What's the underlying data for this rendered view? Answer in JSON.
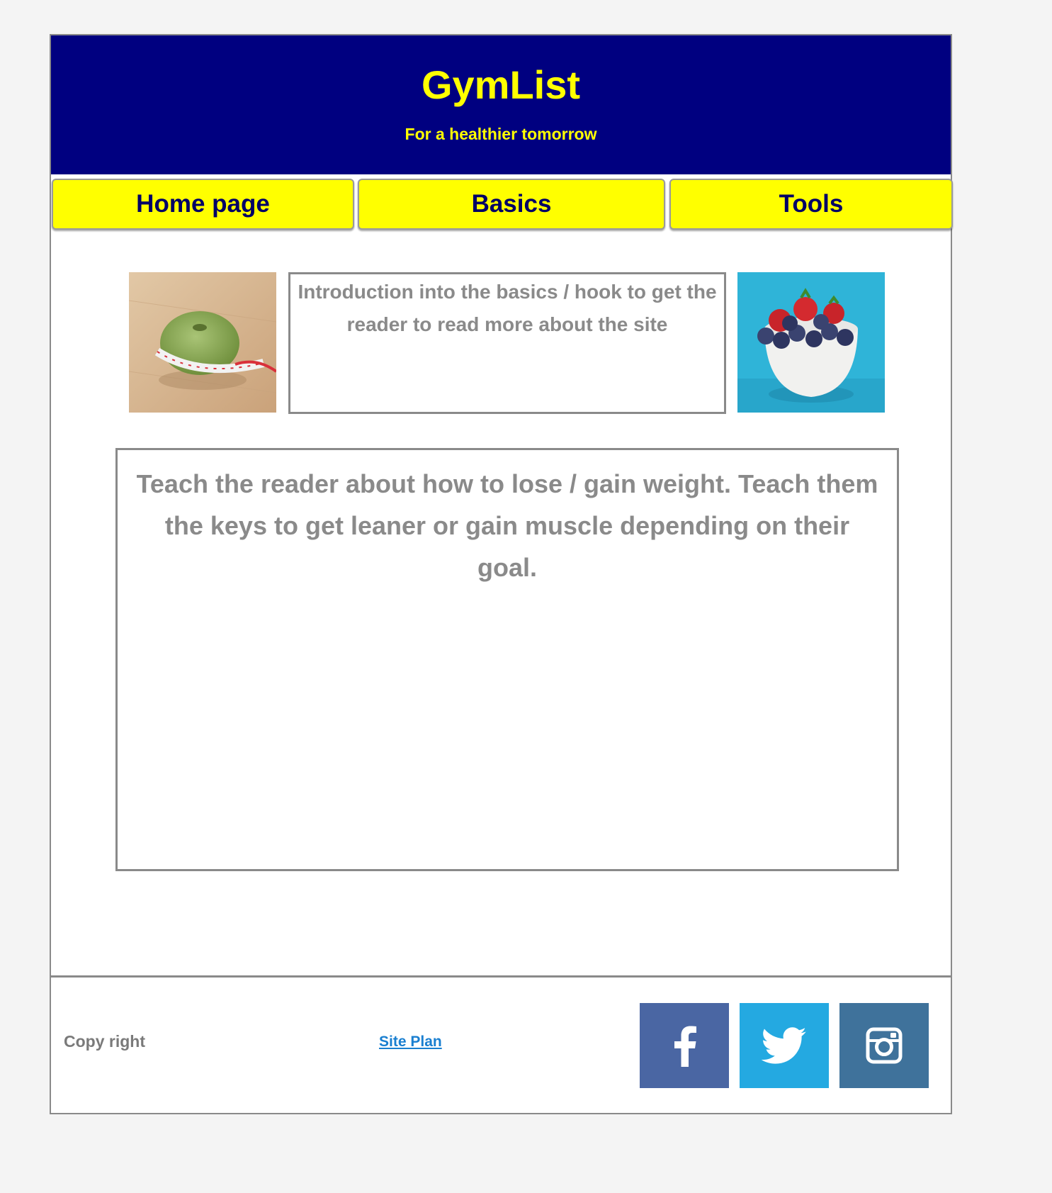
{
  "header": {
    "title": "GymList",
    "tagline": "For a healthier tomorrow",
    "background_color": "#000080",
    "text_color": "#ffff00"
  },
  "nav": {
    "items": [
      {
        "label": "Home page"
      },
      {
        "label": "Basics"
      },
      {
        "label": "Tools"
      }
    ],
    "button_color": "#ffff00",
    "text_color": "#000066"
  },
  "main": {
    "intro_text": "Introduction into the basics / hook to get the reader to read more about the site",
    "content_text": "Teach the reader about how to lose / gain weight. Teach them the keys to get leaner or gain muscle depending on their goal.",
    "images": [
      {
        "icon": "apple-measuring-tape-image"
      },
      {
        "icon": "berries-bowl-image"
      }
    ]
  },
  "footer": {
    "copyright": "Copy right",
    "site_plan_link": "Site Plan",
    "social": [
      {
        "icon": "facebook-icon",
        "color": "#4a66a3"
      },
      {
        "icon": "twitter-icon",
        "color": "#24a9e1"
      },
      {
        "icon": "instagram-icon",
        "color": "#3f729b"
      }
    ]
  }
}
